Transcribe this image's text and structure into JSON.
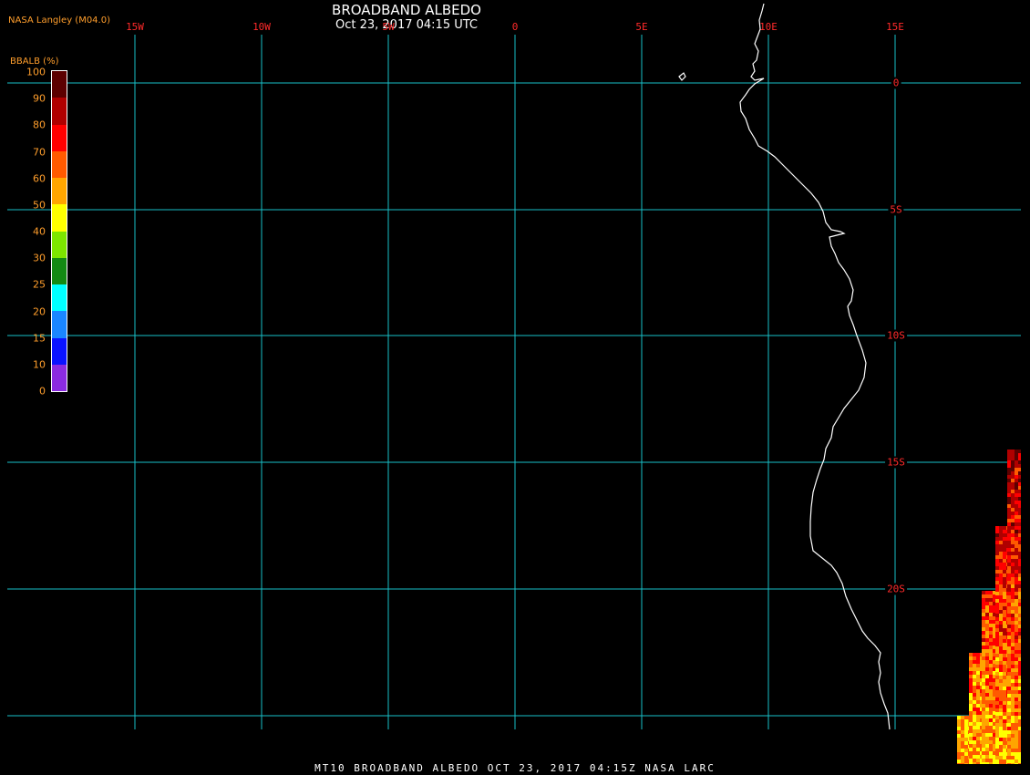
{
  "header": {
    "title": "BROADBAND ALBEDO",
    "subtitle": "Oct 23, 2017 04:15 UTC",
    "credit": "NASA Langley (M04.0)"
  },
  "footer": {
    "text": "MT10  BROADBAND ALBEDO   OCT 23, 2017 04:15Z   NASA LARC"
  },
  "grid": {
    "color": "#19c0c8",
    "lon_labels": [
      "15W",
      "10W",
      "5W",
      "0",
      "5E",
      "10E",
      "15E"
    ],
    "lat_labels": [
      "0",
      "5S",
      "10S",
      "15S",
      "20S"
    ]
  },
  "legend": {
    "title": "BBALB (%)",
    "ticks": [
      "100",
      "90",
      "80",
      "70",
      "60",
      "50",
      "40",
      "30",
      "25",
      "20",
      "15",
      "10",
      "0"
    ],
    "colors": [
      "#8b2be0",
      "#0a12ff",
      "#1a86ff",
      "#00ffff",
      "#138a13",
      "#7de600",
      "#ffff00",
      "#ffa500",
      "#ff5a00",
      "#ff0000",
      "#b00000",
      "#5c0000"
    ]
  },
  "map": {
    "coastline_color": "#ffffff",
    "albedo_palette": [
      "#ff0000",
      "#b00000",
      "#5c0000",
      "#ff5a00",
      "#ffa500",
      "#ffff00"
    ]
  }
}
